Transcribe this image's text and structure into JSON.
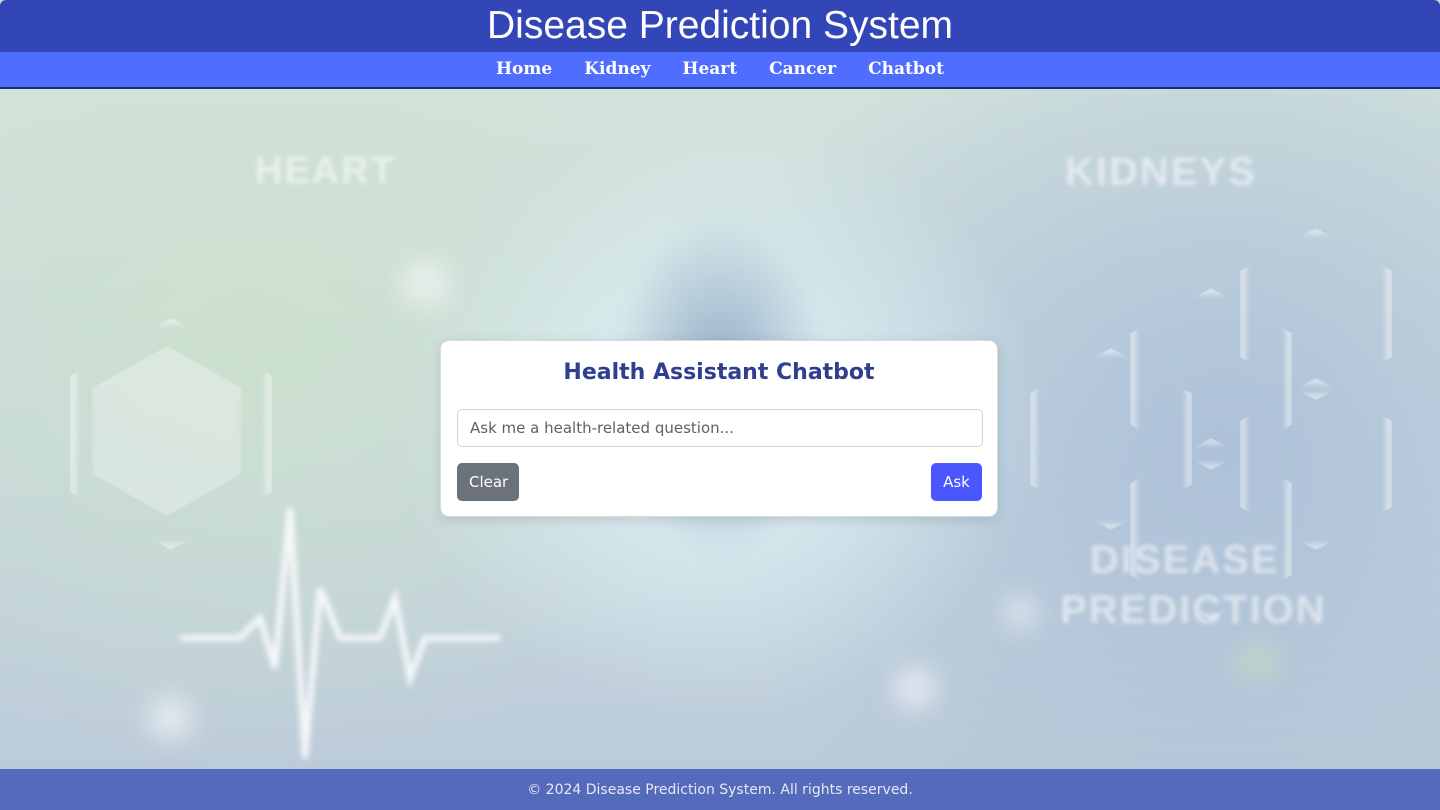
{
  "header": {
    "title": "Disease Prediction System"
  },
  "nav": {
    "items": [
      {
        "label": "Home"
      },
      {
        "label": "Kidney"
      },
      {
        "label": "Heart"
      },
      {
        "label": "Cancer"
      },
      {
        "label": "Chatbot"
      }
    ]
  },
  "chatbot": {
    "title": "Health Assistant Chatbot",
    "input": {
      "value": "",
      "placeholder": "Ask me a health-related question..."
    },
    "clear_label": "Clear",
    "ask_label": "Ask"
  },
  "footer": {
    "text": "© 2024 Disease Prediction System. All rights reserved."
  },
  "background": {
    "ghost_texts": [
      "HEART",
      "KIDNEYS",
      "DISEASE",
      "PREDICTION"
    ]
  },
  "colors": {
    "title_bar": "#3346b8",
    "nav_bar": "#4f6dff",
    "ask_button": "#4a57ff",
    "clear_button": "#6c727b",
    "chat_title": "#2f3f8f"
  }
}
